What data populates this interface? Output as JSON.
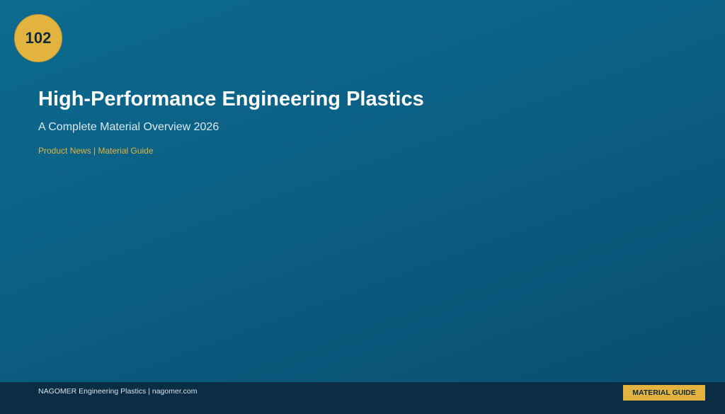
{
  "badge": {
    "number": "102"
  },
  "header": {
    "title": "High-Performance Engineering Plastics",
    "subtitle": "A Complete Material Overview 2026",
    "category": "Product News | Material Guide"
  },
  "footer": {
    "credit": "NAGOMER Engineering Plastics | nagomer.com",
    "tag": "MATERIAL GUIDE"
  },
  "colors": {
    "background": "#0b5f83",
    "accent": "#e3b33f",
    "footer": "#0a2c45"
  }
}
